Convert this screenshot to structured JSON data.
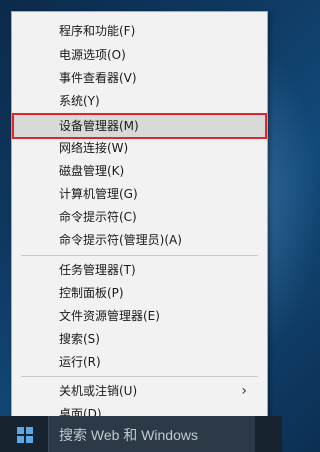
{
  "menu": {
    "items": [
      {
        "label": "程序和功能(F)"
      },
      {
        "label": "电源选项(O)"
      },
      {
        "label": "事件查看器(V)"
      },
      {
        "label": "系统(Y)"
      },
      {
        "label": "设备管理器(M)"
      },
      {
        "label": "网络连接(W)"
      },
      {
        "label": "磁盘管理(K)"
      },
      {
        "label": "计算机管理(G)"
      },
      {
        "label": "命令提示符(C)"
      },
      {
        "label": "命令提示符(管理员)(A)"
      },
      {
        "label": "任务管理器(T)"
      },
      {
        "label": "控制面板(P)"
      },
      {
        "label": "文件资源管理器(E)"
      },
      {
        "label": "搜索(S)"
      },
      {
        "label": "运行(R)"
      },
      {
        "label": "关机或注销(U)"
      },
      {
        "label": "桌面(D)"
      }
    ],
    "submenu_arrow": "›",
    "highlight_color": "#e0262a"
  },
  "taskbar": {
    "search_text": "搜索 Web 和 Windows",
    "start_icon": "windows-logo-icon"
  }
}
